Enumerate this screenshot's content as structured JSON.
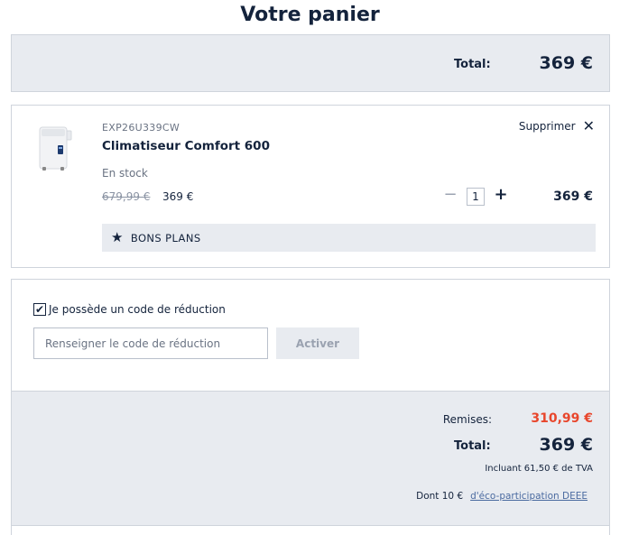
{
  "page": {
    "title": "Votre panier"
  },
  "top_summary": {
    "total_label": "Total:",
    "total_value": "369 €"
  },
  "cart_item": {
    "image_icon": "air-conditioner-image",
    "sku": "EXP26U339CW",
    "name": "Climatiseur Comfort 600",
    "stock": "En stock",
    "old_price": "679,99 €",
    "price": "369 €",
    "remove_label": "Supprimer",
    "remove_icon": "close-icon",
    "quantity": "1",
    "minus_icon": "minus-icon",
    "plus_icon": "plus-icon",
    "line_total": "369 €",
    "badge_icon": "star-icon",
    "badge_label": "BONS PLANS"
  },
  "promo": {
    "checkbox_checked": true,
    "checkbox_label": "Je possède un code de réduction",
    "input_placeholder": "Renseigner le code de réduction",
    "input_value": "",
    "activate_label": "Activer"
  },
  "summary": {
    "discount_label": "Remises:",
    "discount_value": "310,99 €",
    "total_label": "Total:",
    "total_value": "369 €",
    "vat_note": "Incluant 61,50 € de TVA",
    "eco_prefix": "Dont 10 €",
    "eco_link": "d'éco-participation DEEE"
  },
  "colors": {
    "primary_text": "#14233c",
    "discount_red": "#e8462c",
    "panel_grey": "#e8ebf0",
    "link_blue": "#4a6aa0"
  }
}
